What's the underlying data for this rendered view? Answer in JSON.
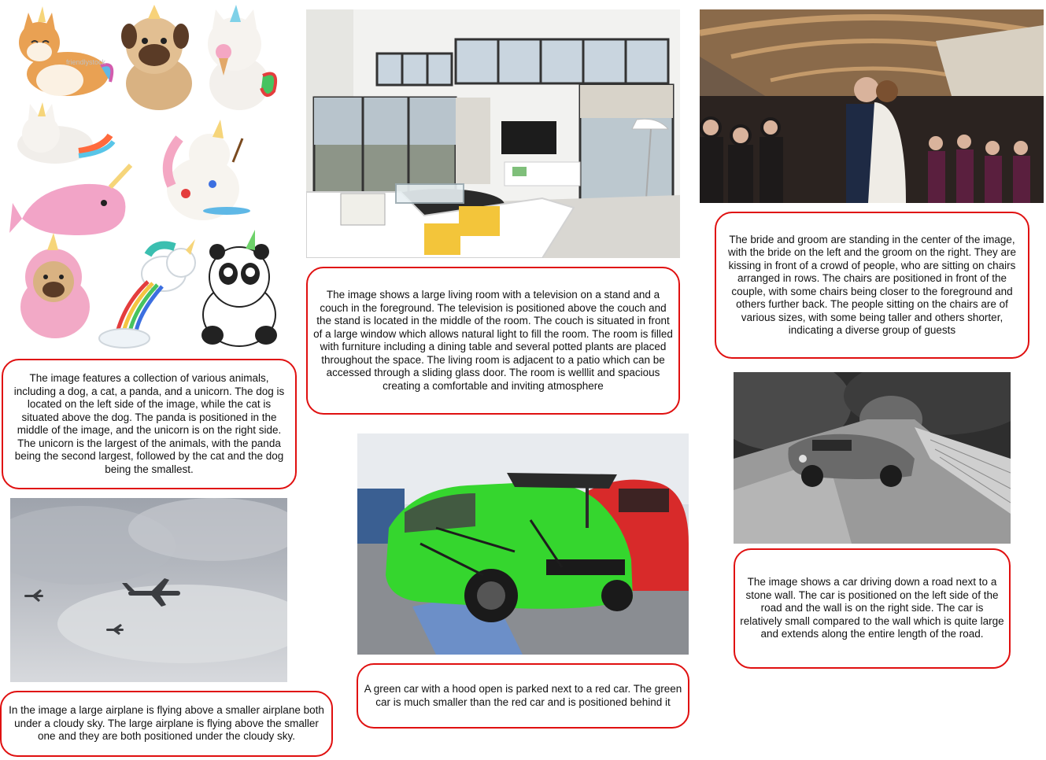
{
  "captions": {
    "animals": "The image features a collection of various animals, including a dog, a cat, a panda, and a unicorn. The dog is located on the left side of the image, while the cat is situated above the dog. The panda is positioned in the middle of the image, and the unicorn is on the right side. The unicorn is the largest of the animals, with the panda being the second largest, followed by the cat and the dog being the smallest.",
    "living_room": "The image shows a large living room with a television on a stand and a couch in the foreground. The television is positioned above the couch and the stand is located in the middle of the room. The couch is situated in front of a large window which allows natural light to fill the room. The room is filled with furniture including a dining table and several potted plants are placed throughout the space. The living room is adjacent to a patio which can be accessed through a sliding glass door. The room is welllit and spacious creating a comfortable and inviting atmosphere",
    "wedding": "The bride and groom are standing in the center of the image, with the bride on the left and the groom on the right. They are kissing in front of a crowd of people, who are sitting on chairs arranged in rows. The chairs are positioned in front of the couple, with some chairs being closer to the foreground and others further back. The people sitting on the chairs are of various sizes, with some being taller and others shorter, indicating a diverse group of guests",
    "airplanes": "In the image a large airplane is flying above a smaller airplane both under a cloudy sky. The large airplane is flying above the smaller one and they are both positioned under the cloudy sky.",
    "green_car": "A green car with a hood open is parked next to a red car. The green car is much smaller than the red car and is positioned behind it",
    "old_car": "The image shows a car driving down a road next to a stone wall. The car is positioned on the left side of the road and the wall is on the right side. The car is relatively small compared to the wall which is quite large and extends along the entire length of the road."
  },
  "watermark": "friendlystock",
  "colors": {
    "caption_border": "#e01010",
    "background": "#ffffff"
  }
}
